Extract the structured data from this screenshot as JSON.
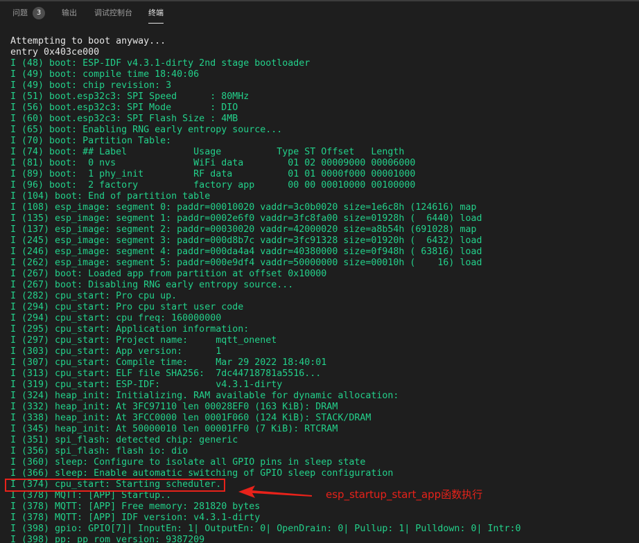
{
  "panel": {
    "tabs": [
      {
        "label": "问题",
        "badge": "3"
      },
      {
        "label": "输出"
      },
      {
        "label": "调试控制台"
      },
      {
        "label": "终端"
      }
    ],
    "active_tab": "终端"
  },
  "terminal_lines": [
    {
      "text": "Attempting to boot anyway...",
      "color": "white"
    },
    {
      "text": "entry 0x403ce000",
      "color": "white"
    },
    {
      "text": "I (48) boot: ESP-IDF v4.3.1-dirty 2nd stage bootloader",
      "color": "green"
    },
    {
      "text": "I (49) boot: compile time 18:40:06",
      "color": "green"
    },
    {
      "text": "I (49) boot: chip revision: 3",
      "color": "green"
    },
    {
      "text": "I (51) boot.esp32c3: SPI Speed      : 80MHz",
      "color": "green"
    },
    {
      "text": "I (56) boot.esp32c3: SPI Mode       : DIO",
      "color": "green"
    },
    {
      "text": "I (60) boot.esp32c3: SPI Flash Size : 4MB",
      "color": "green"
    },
    {
      "text": "I (65) boot: Enabling RNG early entropy source...",
      "color": "green"
    },
    {
      "text": "I (70) boot: Partition Table:",
      "color": "green"
    },
    {
      "text": "I (74) boot: ## Label            Usage          Type ST Offset   Length",
      "color": "green"
    },
    {
      "text": "I (81) boot:  0 nvs              WiFi data        01 02 00009000 00006000",
      "color": "green"
    },
    {
      "text": "I (89) boot:  1 phy_init         RF data          01 01 0000f000 00001000",
      "color": "green"
    },
    {
      "text": "I (96) boot:  2 factory          factory app      00 00 00010000 00100000",
      "color": "green"
    },
    {
      "text": "I (104) boot: End of partition table",
      "color": "green"
    },
    {
      "text": "I (108) esp_image: segment 0: paddr=00010020 vaddr=3c0b0020 size=1e6c8h (124616) map",
      "color": "green"
    },
    {
      "text": "I (135) esp_image: segment 1: paddr=0002e6f0 vaddr=3fc8fa00 size=01928h (  6440) load",
      "color": "green"
    },
    {
      "text": "I (137) esp_image: segment 2: paddr=00030020 vaddr=42000020 size=a8b54h (691028) map",
      "color": "green"
    },
    {
      "text": "I (245) esp_image: segment 3: paddr=000d8b7c vaddr=3fc91328 size=01920h (  6432) load",
      "color": "green"
    },
    {
      "text": "I (246) esp_image: segment 4: paddr=000da4a4 vaddr=40380000 size=0f948h ( 63816) load",
      "color": "green"
    },
    {
      "text": "I (262) esp_image: segment 5: paddr=000e9df4 vaddr=50000000 size=00010h (    16) load",
      "color": "green"
    },
    {
      "text": "I (267) boot: Loaded app from partition at offset 0x10000",
      "color": "green"
    },
    {
      "text": "I (267) boot: Disabling RNG early entropy source...",
      "color": "green"
    },
    {
      "text": "I (282) cpu_start: Pro cpu up.",
      "color": "green"
    },
    {
      "text": "I (294) cpu_start: Pro cpu start user code",
      "color": "green"
    },
    {
      "text": "I (294) cpu_start: cpu freq: 160000000",
      "color": "green"
    },
    {
      "text": "I (295) cpu_start: Application information:",
      "color": "green"
    },
    {
      "text": "I (297) cpu_start: Project name:     mqtt_onenet",
      "color": "green"
    },
    {
      "text": "I (303) cpu_start: App version:      1",
      "color": "green"
    },
    {
      "text": "I (307) cpu_start: Compile time:     Mar 29 2022 18:40:01",
      "color": "green"
    },
    {
      "text": "I (313) cpu_start: ELF file SHA256:  7dc44718781a5516...",
      "color": "green"
    },
    {
      "text": "I (319) cpu_start: ESP-IDF:          v4.3.1-dirty",
      "color": "green"
    },
    {
      "text": "I (324) heap_init: Initializing. RAM available for dynamic allocation:",
      "color": "green"
    },
    {
      "text": "I (332) heap_init: At 3FC97110 len 00028EF0 (163 KiB): DRAM",
      "color": "green"
    },
    {
      "text": "I (338) heap_init: At 3FCC0000 len 0001F060 (124 KiB): STACK/DRAM",
      "color": "green"
    },
    {
      "text": "I (345) heap_init: At 50000010 len 00001FF0 (7 KiB): RTCRAM",
      "color": "green"
    },
    {
      "text": "I (351) spi_flash: detected chip: generic",
      "color": "green"
    },
    {
      "text": "I (356) spi_flash: flash io: dio",
      "color": "green"
    },
    {
      "text": "I (360) sleep: Configure to isolate all GPIO pins in sleep state",
      "color": "green"
    },
    {
      "text": "I (366) sleep: Enable automatic switching of GPIO sleep configuration",
      "color": "green"
    },
    {
      "text": "I (374) cpu_start: Starting scheduler.",
      "color": "green"
    },
    {
      "text": "I (378) MQTT: [APP] Startup..",
      "color": "green"
    },
    {
      "text": "I (378) MQTT: [APP] Free memory: 281820 bytes",
      "color": "green"
    },
    {
      "text": "I (378) MQTT: [APP] IDF version: v4.3.1-dirty",
      "color": "green"
    },
    {
      "text": "I (398) gpio: GPIO[7]| InputEn: 1| OutputEn: 0| OpenDrain: 0| Pullup: 1| Pulldown: 0| Intr:0",
      "color": "green"
    },
    {
      "text": "I (398) pp: pp rom version: 9387209",
      "color": "green"
    }
  ],
  "annotation": {
    "label": "esp_startup_start_app函数执行",
    "color": "#e8221a"
  },
  "colors": {
    "background": "#1e1e1e",
    "log_green": "#23d18b",
    "log_white": "#e5e5e5",
    "accent_red": "#e8221a"
  }
}
